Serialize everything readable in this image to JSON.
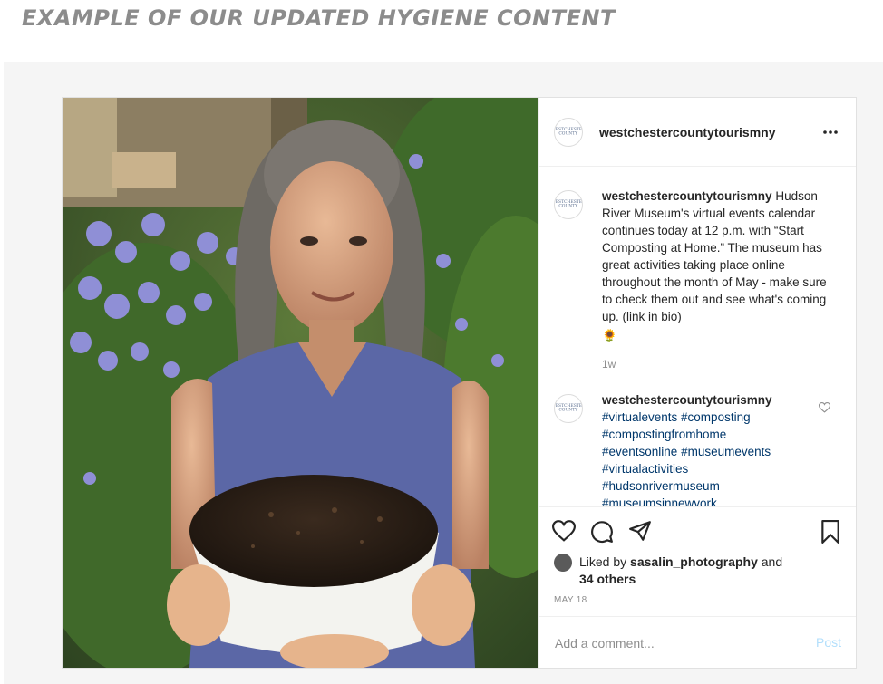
{
  "heading": "EXAMPLE OF OUR UPDATED HYGIENE CONTENT",
  "post": {
    "username": "westchestercountytourismny",
    "avatar_text": "WESTCHESTER COUNTY",
    "caption": {
      "username": "westchestercountytourismny",
      "text": "Hudson River Museum's virtual events calendar continues today at 12 p.m. with “Start Composting at Home.” The museum has great activities taking place online throughout the month of May - make sure to check them out and see what's coming up. (link in bio)",
      "emoji": "🌻",
      "time": "1w"
    },
    "hashtag_comment": {
      "username": "westchestercountytourismny",
      "tags": [
        "#virtualevents #composting",
        "#compostingfromhome",
        "#eventsonline #museumevents",
        "#virtualactivities",
        "#hudsonrivermuseum",
        "#museumsinnewyork"
      ]
    },
    "likes": {
      "prefix": "Liked by",
      "user": "sasalin_photography",
      "and": "and",
      "others": "34 others"
    },
    "date": "MAY 18",
    "comment_placeholder": "Add a comment...",
    "post_label": "Post",
    "icons": [
      "more-icon",
      "heart-icon",
      "comment-icon",
      "share-icon",
      "bookmark-icon"
    ]
  },
  "colors": {
    "heading": "#8c8c8c",
    "link": "#00376b",
    "post_disabled": "#b2dffc",
    "muted": "#8e8e8e"
  }
}
